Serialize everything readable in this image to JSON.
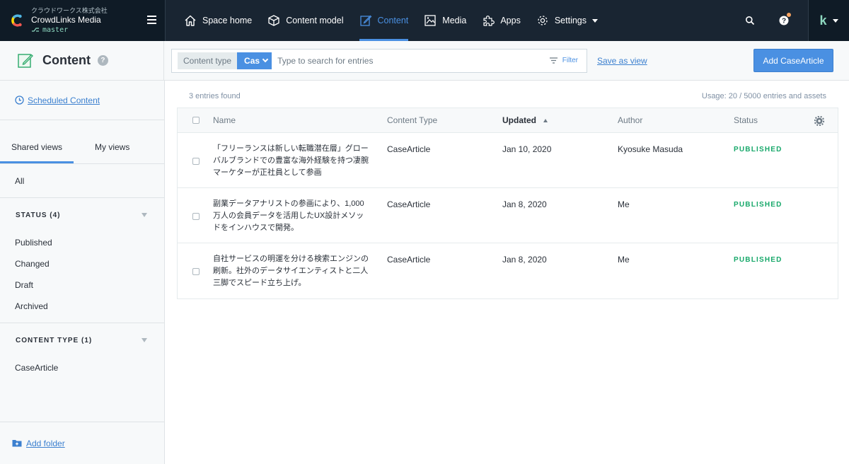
{
  "space": {
    "org": "クラウドワークス株式会社",
    "name": "CrowdLinks Media",
    "environment": "master"
  },
  "nav": {
    "items": [
      {
        "label": "Space home",
        "icon": "house-icon"
      },
      {
        "label": "Content model",
        "icon": "cube-icon"
      },
      {
        "label": "Content",
        "icon": "edit-icon",
        "active": true
      },
      {
        "label": "Media",
        "icon": "image-icon"
      },
      {
        "label": "Apps",
        "icon": "puzzle-icon"
      },
      {
        "label": "Settings",
        "icon": "gear-icon"
      }
    ]
  },
  "colors": {
    "nav_bg": "#192532",
    "accent": "#4a90e2",
    "published": "#17a86a",
    "notification": "#f4a261"
  },
  "header": {
    "title": "Content",
    "help": "?",
    "content_type_label": "Content type",
    "content_type_value": "Cas",
    "search_placeholder": "Type to search for entries",
    "filter_label": "Filter",
    "save_as_view": "Save as view",
    "add_button": "Add CaseArticle"
  },
  "sidebar": {
    "scheduled": "Scheduled Content",
    "tabs": {
      "shared": "Shared views",
      "mine": "My views"
    },
    "all": "All",
    "status_folder": "STATUS (4)",
    "status_items": [
      "Published",
      "Changed",
      "Draft",
      "Archived"
    ],
    "content_type_folder": "CONTENT TYPE (1)",
    "content_type_items": [
      "CaseArticle"
    ],
    "add_folder": "Add folder"
  },
  "main": {
    "found": "3 entries found",
    "usage": "Usage: 20 / 5000 entries and assets",
    "columns": {
      "name": "Name",
      "type": "Content Type",
      "updated": "Updated",
      "author": "Author",
      "status": "Status"
    },
    "rows": [
      {
        "name": "「フリーランスは新しい転職潜在層」グローバルブランドでの豊富な海外経験を持つ凄腕マーケターが正社員として参画",
        "type": "CaseArticle",
        "updated": "Jan 10, 2020",
        "author": "Kyosuke Masuda",
        "status": "PUBLISHED"
      },
      {
        "name": "副業データアナリストの参画により、1,000万人の会員データを活用したUX設計メソッドをインハウスで開発。",
        "type": "CaseArticle",
        "updated": "Jan 8, 2020",
        "author": "Me",
        "status": "PUBLISHED"
      },
      {
        "name": "自社サービスの明運を分ける検索エンジンの刷新。社外のデータサイエンティストと二人三脚でスピード立ち上げ。",
        "type": "CaseArticle",
        "updated": "Jan 8, 2020",
        "author": "Me",
        "status": "PUBLISHED"
      }
    ]
  }
}
